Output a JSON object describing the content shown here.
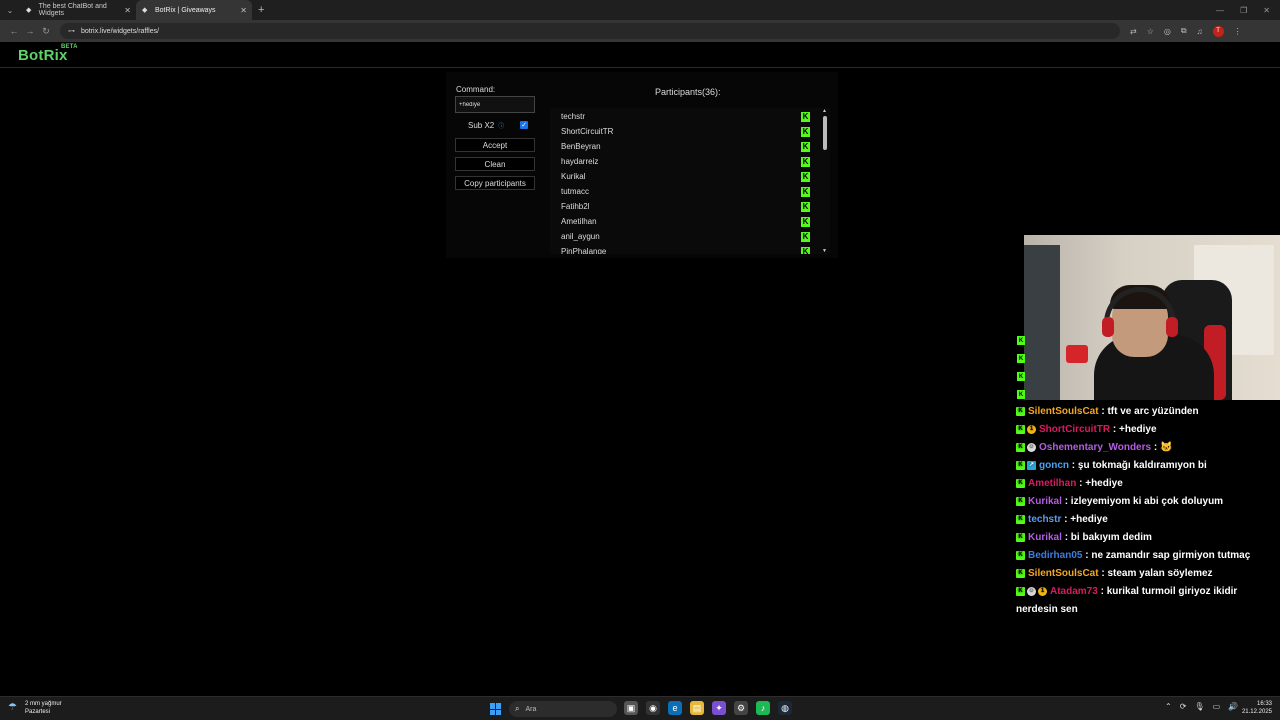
{
  "browser": {
    "tabs": [
      {
        "label": "The best ChatBot and Widgets",
        "active": false
      },
      {
        "label": "BotRix | Giveaways",
        "active": true
      }
    ],
    "url": "botrix.live/widgets/raffles/"
  },
  "app": {
    "logo": "BotRix",
    "logo_badge": "BETA"
  },
  "raffle": {
    "command_label": "Command:",
    "command_value": "+hediye",
    "sub_label": "Sub X2",
    "sub_checked": true,
    "accept_label": "Accept",
    "clean_label": "Clean",
    "copy_label": "Copy participants",
    "participants_title": "Participants(36):",
    "participants": [
      "techstr",
      "ShortCircuitTR",
      "BenBeyran",
      "haydarreiz",
      "Kurikal",
      "tutmacc",
      "Fatihb2l",
      "Ametilhan",
      "anil_aygun",
      "PinPhalange"
    ]
  },
  "chat": {
    "messages": [
      {
        "user": "SilentSoulsCat",
        "color": "#f5a623",
        "badges": [
          "kick"
        ],
        "text": ": tft ve arc yüzünden"
      },
      {
        "user": "ShortCircuitTR",
        "color": "#d81b60",
        "badges": [
          "kick",
          "sub"
        ],
        "text": ": +hediye"
      },
      {
        "user": "Oshementary_Wonders",
        "color": "#b25ee0",
        "badges": [
          "kick",
          "og"
        ],
        "text": ": 🐱"
      },
      {
        "user": "goncn",
        "color": "#4aa3f0",
        "badges": [
          "kick",
          "vip"
        ],
        "text": ": şu tokmağı kaldıramıyon bi"
      },
      {
        "user": "Ametilhan",
        "color": "#d81b60",
        "badges": [
          "kick"
        ],
        "text": ": +hediye"
      },
      {
        "user": "Kurikal",
        "color": "#b25ee0",
        "badges": [
          "kick"
        ],
        "text": ": izleyemiyom ki abi çok doluyum"
      },
      {
        "user": "techstr",
        "color": "#5b9bf0",
        "badges": [
          "kick"
        ],
        "text": ": +hediye"
      },
      {
        "user": "Kurikal",
        "color": "#b25ee0",
        "badges": [
          "kick"
        ],
        "text": ": bi bakıyım dedim"
      },
      {
        "user": "Bedirhan05",
        "color": "#3b7de0",
        "badges": [
          "kick"
        ],
        "text": ": ne zamandır sap girmiyon tutmaç"
      },
      {
        "user": "SilentSoulsCat",
        "color": "#f5a623",
        "badges": [
          "kick"
        ],
        "text": ": steam yalan söylemez"
      },
      {
        "user": "Atadam73",
        "color": "#d81b60",
        "badges": [
          "kick",
          "og",
          "sub"
        ],
        "text": ": kurikal turmoil giriyoz ikidir nerdesin sen"
      }
    ]
  },
  "taskbar": {
    "weather_line1": "2 mm yağmur",
    "weather_line2": "Pazartesi",
    "search_placeholder": "Ara",
    "time": "16:33",
    "date": "21.12.2025"
  },
  "colors": {
    "brand": "#5dd36a",
    "kick_green": "#53fc18"
  }
}
